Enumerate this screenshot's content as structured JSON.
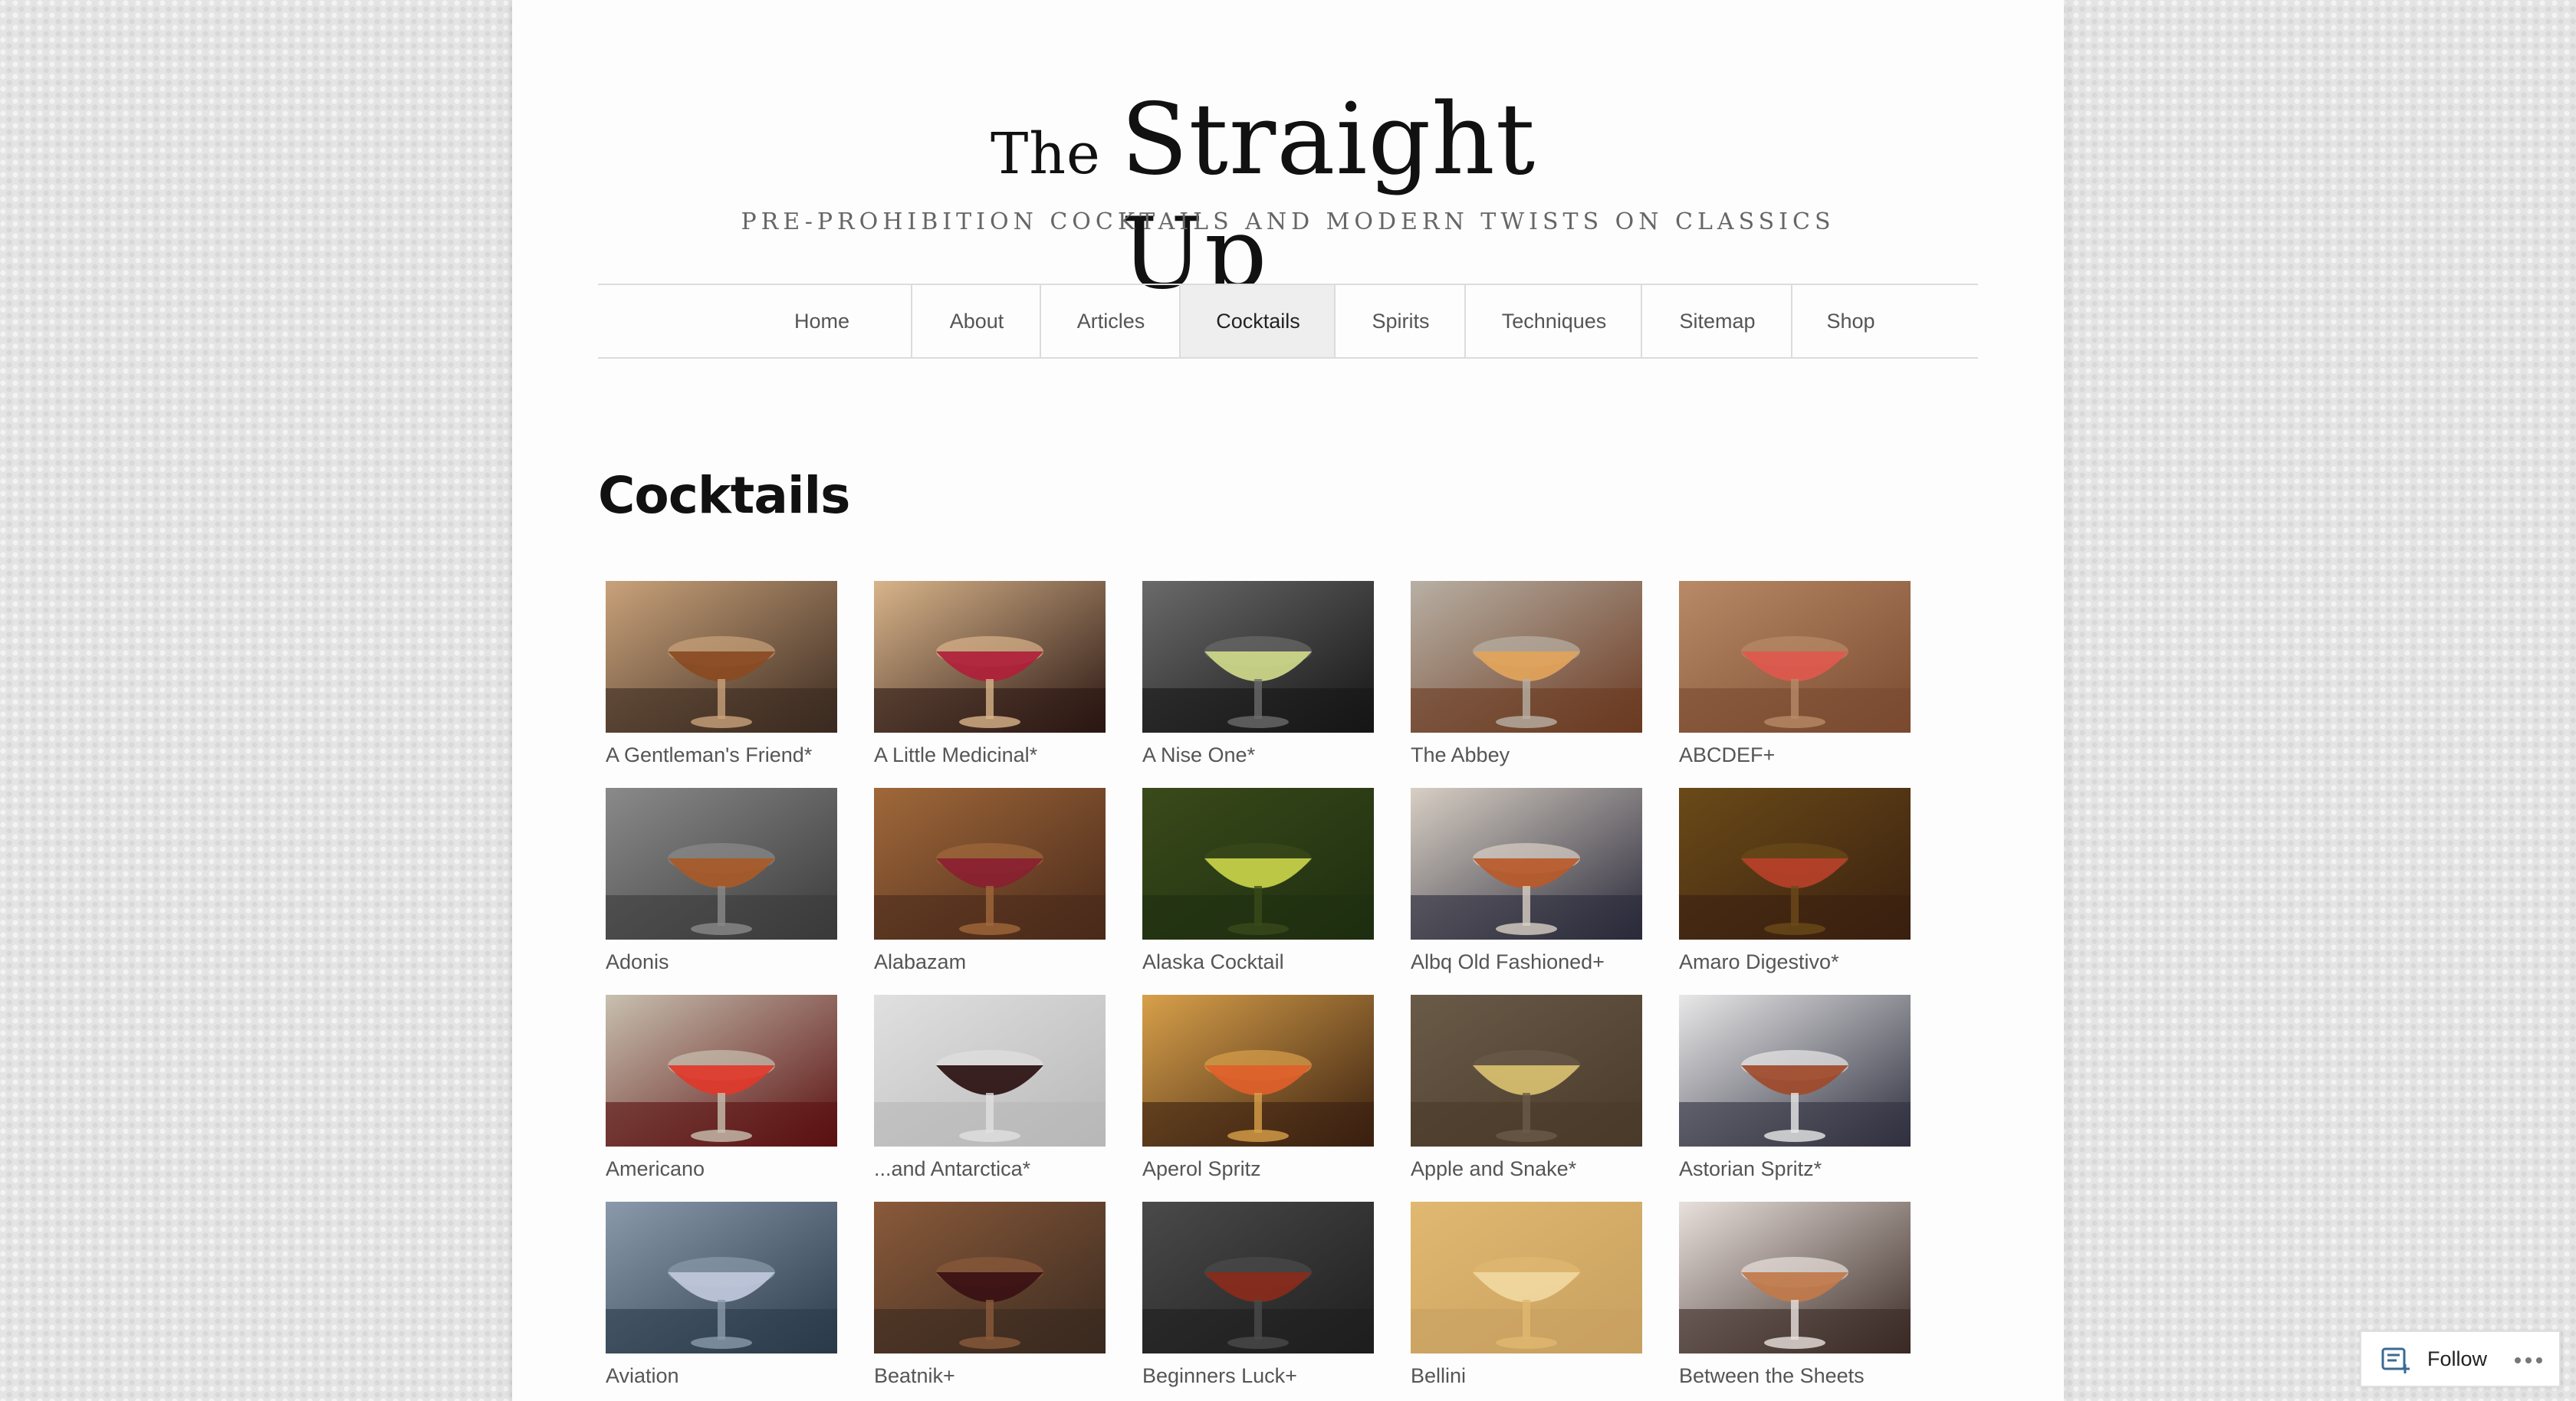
{
  "site": {
    "logo_the": "The",
    "logo_name": "Straight Up",
    "tagline": "PRE-PROHIBITION COCKTAILS AND MODERN TWISTS ON CLASSICS"
  },
  "nav": {
    "items": [
      {
        "label": "Home"
      },
      {
        "label": "About"
      },
      {
        "label": "Articles"
      },
      {
        "label": "Cocktails",
        "active": true
      },
      {
        "label": "Spirits"
      },
      {
        "label": "Techniques"
      },
      {
        "label": "Sitemap"
      },
      {
        "label": "Shop"
      }
    ]
  },
  "page": {
    "title": "Cocktails"
  },
  "cocktails": [
    {
      "title": "A Gentleman's Friend*",
      "colors": [
        "#3b2a20",
        "#8a4a22",
        "#c9a27a"
      ]
    },
    {
      "title": "A Little Medicinal*",
      "colors": [
        "#2a1612",
        "#b0203a",
        "#d8b48a"
      ]
    },
    {
      "title": "A Nise One*",
      "colors": [
        "#151515",
        "#cfd98a",
        "#6a6a6a"
      ]
    },
    {
      "title": "The Abbey",
      "colors": [
        "#6b3a22",
        "#e2a45a",
        "#b8b0a4"
      ]
    },
    {
      "title": "ABCDEF+",
      "colors": [
        "#7a4a30",
        "#e0584e",
        "#b88a66"
      ]
    },
    {
      "title": "Adonis",
      "colors": [
        "#3a3a3a",
        "#a85a28",
        "#8a8a8a"
      ]
    },
    {
      "title": "Alabazam",
      "colors": [
        "#4a2a1a",
        "#8a2030",
        "#a0683a"
      ]
    },
    {
      "title": "Alaska Cocktail",
      "colors": [
        "#1e2e10",
        "#c8d44a",
        "#3a4a1a"
      ]
    },
    {
      "title": "Albq Old Fashioned+",
      "colors": [
        "#2a2a3a",
        "#b85a2a",
        "#d8cfc4"
      ]
    },
    {
      "title": "Amaro Digestivo*",
      "colors": [
        "#3a2010",
        "#b8402a",
        "#6a4a18"
      ]
    },
    {
      "title": "Americano",
      "colors": [
        "#5a1010",
        "#e0382a",
        "#c8c0b0"
      ]
    },
    {
      "title": "...and Antarctica*",
      "colors": [
        "#b8b8b8",
        "#2a1010",
        "#e0e0e0"
      ]
    },
    {
      "title": "Aperol Spritz",
      "colors": [
        "#3a2010",
        "#e0602a",
        "#d8a04a"
      ]
    },
    {
      "title": "Apple and Snake*",
      "colors": [
        "#4a3a2a",
        "#d8c070",
        "#6a5a48"
      ]
    },
    {
      "title": "Astorian Spritz*",
      "colors": [
        "#303040",
        "#a04a2a",
        "#e8e8e8"
      ]
    },
    {
      "title": "Aviation",
      "colors": [
        "#2a3a4a",
        "#c0c8dc",
        "#8a9aaa"
      ]
    },
    {
      "title": "Beatnik+",
      "colors": [
        "#3a2a20",
        "#3a1014",
        "#8a5a3a"
      ]
    },
    {
      "title": "Beginners Luck+",
      "colors": [
        "#1e1e1e",
        "#8a2a1a",
        "#4a4a4a"
      ]
    },
    {
      "title": "Bellini",
      "colors": [
        "#c8a060",
        "#f0d8a0",
        "#e0b870"
      ]
    },
    {
      "title": "Between the Sheets",
      "colors": [
        "#3a2a24",
        "#c07a4a",
        "#e8e0dc"
      ]
    }
  ],
  "follow": {
    "label": "Follow",
    "icon": "reader-follow-icon",
    "more_icon": "more-dots-icon"
  }
}
